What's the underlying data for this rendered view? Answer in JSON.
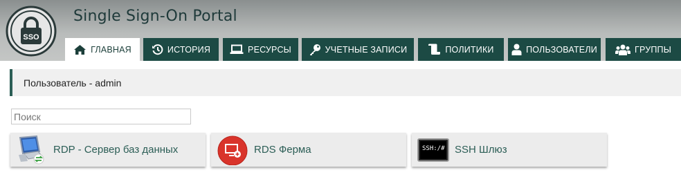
{
  "app": {
    "title": "Single Sign-On Portal",
    "logo_text": "SSO"
  },
  "tabs": [
    {
      "label": "ГЛАВНАЯ",
      "icon": "home-icon"
    },
    {
      "label": "ИСТОРИЯ",
      "icon": "history-icon"
    },
    {
      "label": "РЕСУРСЫ",
      "icon": "laptop-icon"
    },
    {
      "label": "УЧЕТНЫЕ ЗАПИСИ",
      "icon": "key-icon"
    },
    {
      "label": "ПОЛИТИКИ",
      "icon": "scroll-icon"
    },
    {
      "label": "ПОЛЬЗОВАТЕЛИ",
      "icon": "user-icon"
    },
    {
      "label": "ГРУППЫ",
      "icon": "users-icon"
    }
  ],
  "user_bar": {
    "text": "Пользователь - admin"
  },
  "search": {
    "placeholder": "Поиск",
    "value": ""
  },
  "resources": [
    {
      "label": "RDP - Сервер баз данных",
      "icon": "rdp-computer-icon"
    },
    {
      "label": "RDS Ферма",
      "icon": "rds-farm-icon"
    },
    {
      "label": "SSH Шлюз",
      "icon": "ssh-terminal-icon",
      "icon_text": "SSH:/#"
    }
  ],
  "colors": {
    "tab_bg": "#1c4a44",
    "accent": "#2c5e56",
    "rds_red": "#d9342b"
  }
}
